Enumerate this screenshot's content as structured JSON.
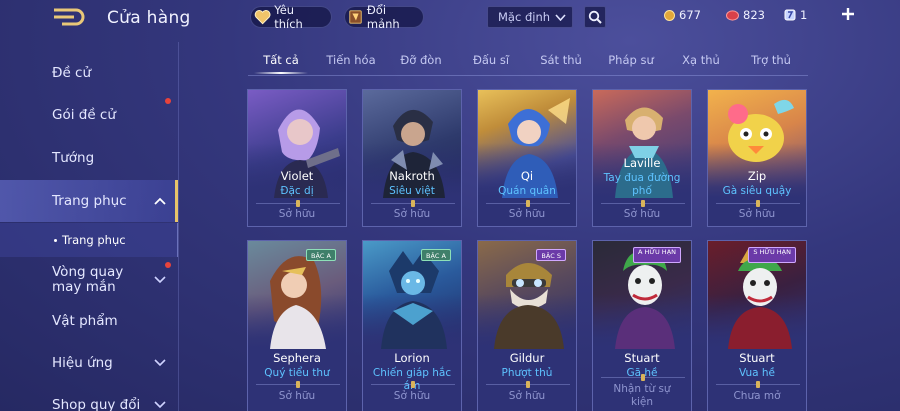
{
  "header": {
    "title": "Cửa hàng",
    "favorite_label": "Yêu thích",
    "exchange_label": "Đổi mảnh",
    "sort_value": "Mặc định",
    "currencies": [
      {
        "icon": "gold-coin-icon",
        "value": "677"
      },
      {
        "icon": "ruby-icon",
        "value": "823"
      },
      {
        "icon": "voucher-icon",
        "value": "1"
      }
    ]
  },
  "sidebar": {
    "items": [
      {
        "label": "Đề cử"
      },
      {
        "label": "Gói đề cử"
      },
      {
        "label": "Tướng"
      },
      {
        "label": "Trang phục"
      },
      {
        "label": "Vòng quay may mắn"
      },
      {
        "label": "Vật phẩm"
      },
      {
        "label": "Hiệu ứng"
      },
      {
        "label": "Shop quy đổi"
      }
    ],
    "sub_item": "Trang phục"
  },
  "tabs": [
    "Tất cả",
    "Tiến hóa",
    "Đỡ đòn",
    "Đấu sĩ",
    "Sát thủ",
    "Pháp sư",
    "Xạ thủ",
    "Trợ thủ"
  ],
  "cards": [
    {
      "name": "Violet",
      "skin": "Đặc dị",
      "status": "Sở hữu",
      "badge": ""
    },
    {
      "name": "Nakroth",
      "skin": "Siêu việt",
      "status": "Sở hữu",
      "badge": ""
    },
    {
      "name": "Qi",
      "skin": "Quán quân",
      "status": "Sở hữu",
      "badge": ""
    },
    {
      "name": "Laville",
      "skin": "Tay đua đường phố",
      "status": "Sở hữu",
      "badge": ""
    },
    {
      "name": "Zip",
      "skin": "Gà siêu quậy",
      "status": "Sở hữu",
      "badge": ""
    },
    {
      "name": "Sephera",
      "skin": "Quý tiểu thư",
      "status": "Sở hữu",
      "badge": "BẬC A"
    },
    {
      "name": "Lorion",
      "skin": "Chiến giáp hắc ám",
      "status": "Sở hữu",
      "badge": "BẬC A"
    },
    {
      "name": "Gildur",
      "skin": "Phượt thủ",
      "status": "Sở hữu",
      "badge": "BẬC S"
    },
    {
      "name": "Stuart",
      "skin": "Gã hề",
      "status": "Nhận từ sự kiện",
      "badge": "A HỮU HẠN"
    },
    {
      "name": "Stuart",
      "skin": "Vua hề",
      "status": "Chưa mở",
      "badge": "S HỮU HẠN"
    }
  ],
  "colors": {
    "background": "#34377d",
    "accent_gold": "#e8c46a",
    "skin_name": "#5ec3ff",
    "notification": "#e8433b"
  }
}
